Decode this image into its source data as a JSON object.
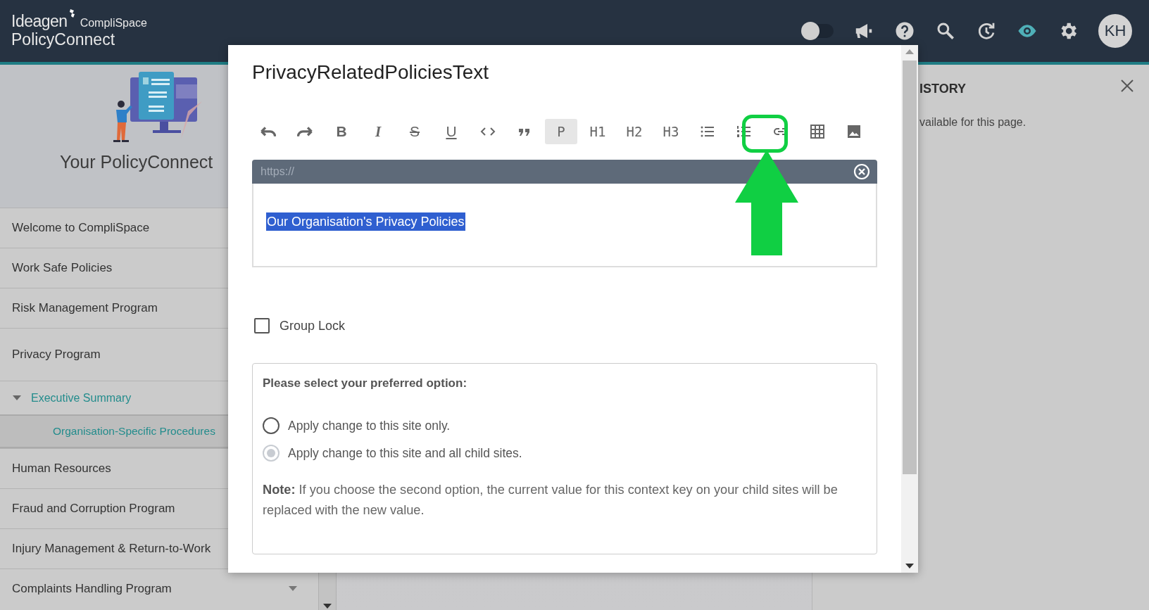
{
  "header": {
    "logo": {
      "brand": "Ideagen",
      "product": "CompliSpace",
      "app": "PolicyConnect"
    },
    "toggle": {
      "on": false
    },
    "icons": [
      {
        "kind": "megaphone",
        "active": false
      },
      {
        "kind": "help",
        "active": false
      },
      {
        "kind": "search",
        "active": false
      },
      {
        "kind": "history",
        "active": false
      },
      {
        "kind": "eye",
        "active": true
      },
      {
        "kind": "gear",
        "active": false
      }
    ],
    "avatar": "KH"
  },
  "sidebar": {
    "hero_title": "Your PolicyConnect",
    "items": [
      {
        "label": "Welcome to CompliSpace",
        "selected": false
      },
      {
        "label": "Work Safe Policies",
        "selected": false
      },
      {
        "label": "Risk Management Program",
        "selected": false
      },
      {
        "label": "Privacy Program",
        "selected": false,
        "children": [
          {
            "label": "Executive Summary",
            "selected": false,
            "expanded": true,
            "children": [
              {
                "label": "Organisation-Specific Procedures",
                "selected": true
              }
            ]
          }
        ]
      },
      {
        "label": "Human Resources",
        "selected": false
      },
      {
        "label": "Fraud and Corruption Program",
        "selected": false
      },
      {
        "label": "Injury Management & Return-to-Work",
        "selected": false
      },
      {
        "label": "Complaints Handling Program",
        "selected": false,
        "expanded": false
      }
    ]
  },
  "history_panel": {
    "title": "ISTORY",
    "message": "vailable for this page."
  },
  "dialog": {
    "title": "PrivacyRelatedPoliciesText",
    "toolbar": [
      {
        "kind": "undo",
        "selected": false,
        "annotated": false
      },
      {
        "kind": "redo",
        "selected": false,
        "annotated": false
      },
      {
        "kind": "bold",
        "label": "B",
        "selected": false,
        "annotated": false
      },
      {
        "kind": "italic",
        "label": "I",
        "selected": false,
        "annotated": false
      },
      {
        "kind": "strike",
        "label": "S",
        "selected": false,
        "annotated": false
      },
      {
        "kind": "underline",
        "label": "U",
        "selected": false,
        "annotated": false
      },
      {
        "kind": "code",
        "selected": false,
        "annotated": false
      },
      {
        "kind": "quote",
        "selected": false,
        "annotated": false
      },
      {
        "kind": "block",
        "label": "P",
        "selected": true,
        "annotated": false
      },
      {
        "kind": "block",
        "label": "H1",
        "selected": false,
        "annotated": false
      },
      {
        "kind": "block",
        "label": "H2",
        "selected": false,
        "annotated": false
      },
      {
        "kind": "block",
        "label": "H3",
        "selected": false,
        "annotated": false
      },
      {
        "kind": "bullet-list",
        "selected": false,
        "annotated": false
      },
      {
        "kind": "numbered-list",
        "selected": false,
        "annotated": false
      },
      {
        "kind": "link",
        "selected": false,
        "annotated": true
      },
      {
        "kind": "table",
        "selected": false,
        "annotated": false
      },
      {
        "kind": "image",
        "selected": false,
        "annotated": false
      }
    ],
    "url_field": {
      "placeholder": "https://"
    },
    "editor_text": "Our Organisation's Privacy Policies",
    "group_lock": {
      "label": "Group Lock",
      "checked": false
    },
    "options": {
      "heading": "Please select your preferred option:",
      "radios": [
        {
          "label": "Apply change to this site only.",
          "selected": false,
          "disabled": false
        },
        {
          "label": "Apply change to this site and all child sites.",
          "selected": true,
          "disabled": true
        }
      ],
      "note": "**Note:** If you choose the second option, the current value for this context key on your child sites will be replaced with the new value."
    }
  }
}
